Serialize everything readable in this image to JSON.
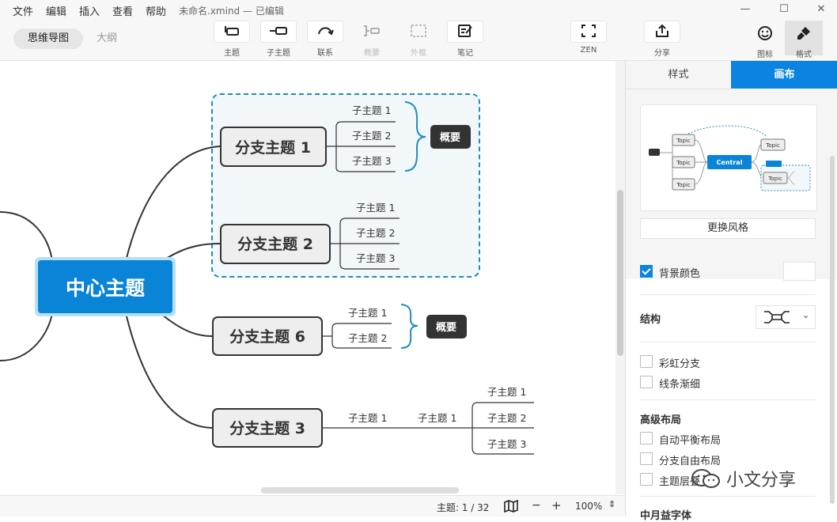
{
  "menu": [
    "文件",
    "编辑",
    "插入",
    "查看",
    "帮助"
  ],
  "window": {
    "title": "未命名.xmind",
    "status": "— 已编辑"
  },
  "view_tabs": [
    {
      "label": "思维导图",
      "active": true
    },
    {
      "label": "大纲",
      "active": false
    }
  ],
  "toolbar": [
    {
      "label": "主题",
      "icon": "topic-icon",
      "enabled": true
    },
    {
      "label": "子主题",
      "icon": "subtopic-icon",
      "enabled": true
    },
    {
      "label": "联系",
      "icon": "relationship-icon",
      "enabled": true
    },
    {
      "label": "概要",
      "icon": "summary-icon",
      "enabled": false
    },
    {
      "label": "外框",
      "icon": "boundary-icon",
      "enabled": false
    },
    {
      "label": "笔记",
      "icon": "note-icon",
      "enabled": true
    },
    {
      "label": "ZEN",
      "icon": "fullscreen-icon",
      "enabled": true
    },
    {
      "label": "分享",
      "icon": "share-icon",
      "enabled": true
    }
  ],
  "right_toolbar": [
    {
      "label": "图标",
      "icon": "smiley-icon",
      "active": false
    },
    {
      "label": "格式",
      "icon": "brush-icon",
      "active": true
    }
  ],
  "mindmap": {
    "central": "中心主题",
    "summary": "概要",
    "branch1": {
      "title": "分支主题 1",
      "subs": [
        "子主题 1",
        "子主题 2",
        "子主题 3"
      ]
    },
    "branch2": {
      "title": "分支主题 2",
      "subs": [
        "子主题 1",
        "子主题 2",
        "子主题 3"
      ]
    },
    "branch6": {
      "title": "分支主题 6",
      "subs": [
        "子主题 1",
        "子主题 2"
      ]
    },
    "branch3": {
      "title": "分支主题 3",
      "sub": "子主题 1",
      "subsub": "子主题 1",
      "leaves": [
        "子主题 1",
        "子主题 2",
        "子主题 3"
      ]
    }
  },
  "status": {
    "topics": "主题: 1 / 32",
    "zoom": "100%"
  },
  "panel": {
    "tabs": [
      {
        "label": "样式",
        "active": false
      },
      {
        "label": "画布",
        "active": true
      }
    ],
    "preview": {
      "central": "Central",
      "topic": "Topic"
    },
    "change_style": "更换风格",
    "bg_color_label": "背景颜色",
    "bg_color_checked": true,
    "structure_label": "结构",
    "rainbow": "彩虹分支",
    "taper": "线条渐细",
    "advanced_title": "高级布局",
    "auto_balance": "自动平衡布局",
    "free_branch": "分支自由布局",
    "topic_overlap": "主题层叠",
    "font_section": "中月益字体"
  },
  "watermark": "小文分享",
  "colors": {
    "accent": "#0a84e0",
    "central": "#0a84d6",
    "branch_fill": "#eeeeee",
    "boundary": "#1f8fb8"
  }
}
